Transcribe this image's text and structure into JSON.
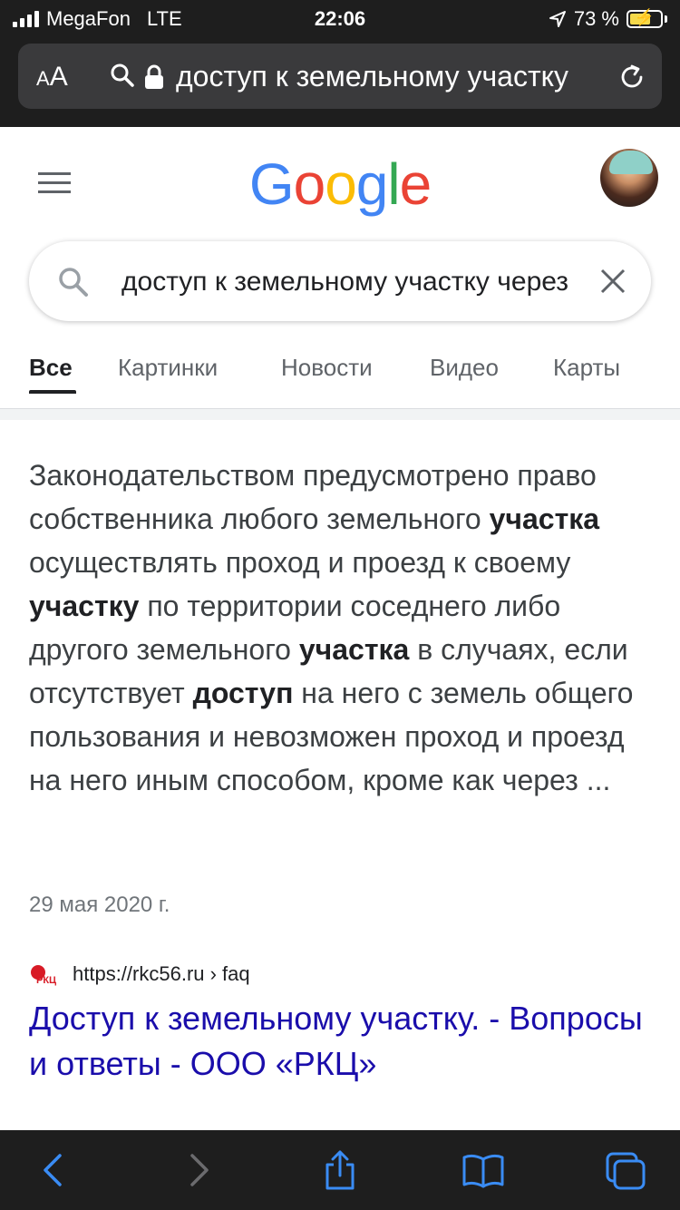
{
  "status_bar": {
    "carrier": "MegaFon",
    "network": "LTE",
    "time": "22:06",
    "battery_percent": "73 %",
    "battery_level": 0.73,
    "icons": [
      "signal-bars-icon",
      "location-arrow-icon",
      "battery-charging-icon"
    ]
  },
  "url_bar": {
    "text_size_label_small": "A",
    "text_size_label_large": "A",
    "url_text": "доступ к земельному участку",
    "icons": [
      "search-icon",
      "lock-icon",
      "reload-icon"
    ]
  },
  "google": {
    "logo": [
      "G",
      "o",
      "o",
      "g",
      "l",
      "e"
    ],
    "logo_colors": [
      "#4285F4",
      "#EA4335",
      "#FBBC05",
      "#4285F4",
      "#34A853",
      "#EA4335"
    ],
    "search_query": "доступ к земельному участку через"
  },
  "tabs": [
    {
      "label": "Все",
      "active": true
    },
    {
      "label": "Картинки",
      "active": false
    },
    {
      "label": "Новости",
      "active": false
    },
    {
      "label": "Видео",
      "active": false
    },
    {
      "label": "Карты",
      "active": false
    }
  ],
  "snippet": {
    "segments": [
      {
        "text": "Законодательством предусмотрено право собственника любого земельного ",
        "bold": false
      },
      {
        "text": "участка",
        "bold": true
      },
      {
        "text": " осуществлять проход и проезд к своему ",
        "bold": false
      },
      {
        "text": "участку",
        "bold": true
      },
      {
        "text": " по территории соседнего либо другого земельного ",
        "bold": false
      },
      {
        "text": "участка",
        "bold": true
      },
      {
        "text": " в случаях, если отсутствует ",
        "bold": false
      },
      {
        "text": "доступ",
        "bold": true
      },
      {
        "text": " на него с земель общего пользования и невозможен проход и проезд на него иным способом, кроме как через ...",
        "bold": false
      }
    ],
    "date": "29 мая 2020 г."
  },
  "result": {
    "source_url": "https://rkc56.ru › faq",
    "title": "Доступ к земельному участку. - Вопросы и ответы - ООО «РКЦ»",
    "favicon_text": "РКЦ",
    "favicon_color": "#d81b26",
    "link_color": "#1a0dab"
  },
  "toolbar": {
    "icons": [
      "back-icon",
      "forward-icon",
      "share-icon",
      "bookmarks-icon",
      "tabs-icon"
    ],
    "accent": "#3a8cf4"
  }
}
